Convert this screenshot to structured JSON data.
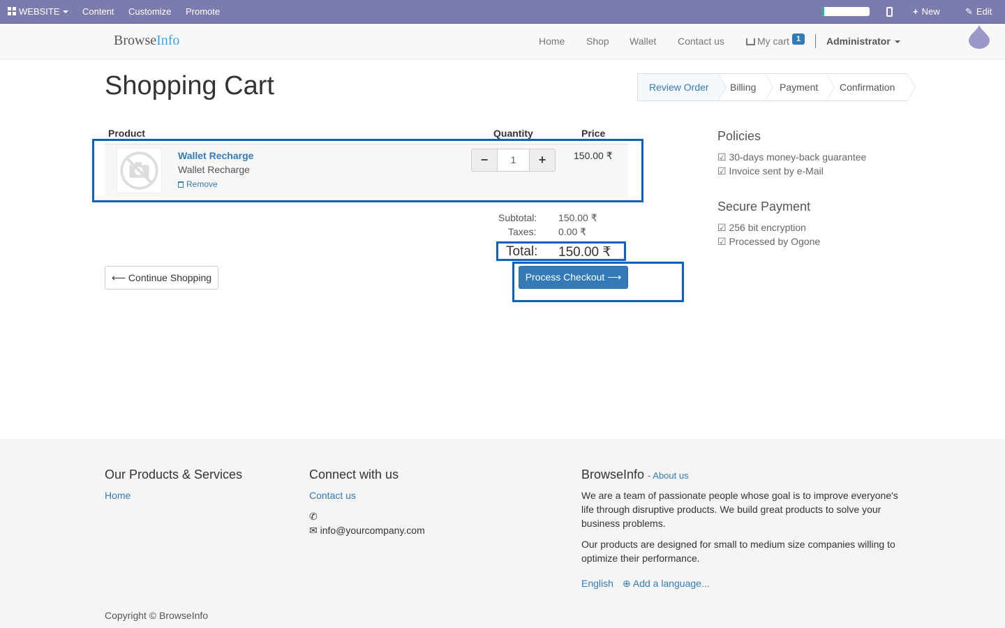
{
  "adminbar": {
    "website_label": "WEBSITE",
    "content_label": "Content",
    "customize_label": "Customize",
    "promote_label": "Promote",
    "new_label": "New",
    "edit_label": "Edit",
    "progress_fraction": 0.04
  },
  "nav": {
    "brand_part1": "Browse",
    "brand_part2": "Info",
    "home": "Home",
    "shop": "Shop",
    "wallet": "Wallet",
    "contact": "Contact us",
    "cart": "My cart",
    "cart_count": "1",
    "user": "Administrator"
  },
  "page": {
    "title": "Shopping Cart",
    "steps": [
      "Review Order",
      "Billing",
      "Payment",
      "Confirmation"
    ]
  },
  "cart": {
    "headers": {
      "product": "Product",
      "quantity": "Quantity",
      "price": "Price"
    },
    "items": [
      {
        "name": "Wallet Recharge",
        "description": "Wallet Recharge",
        "remove": "Remove",
        "quantity": "1",
        "price": "150.00 ₹"
      }
    ],
    "subtotal_label": "Subtotal:",
    "subtotal": "150.00 ₹",
    "taxes_label": "Taxes:",
    "taxes": "0.00 ₹",
    "total_label": "Total:",
    "total": "150.00 ₹",
    "continue_label": "Continue Shopping",
    "checkout_label": "Process Checkout"
  },
  "side": {
    "policies_title": "Policies",
    "policies": [
      "☑ 30-days money-back guarantee",
      "☑ Invoice sent by e-Mail"
    ],
    "secure_title": "Secure Payment",
    "secure": [
      "☑ 256 bit encryption",
      "☑ Processed by Ogone"
    ]
  },
  "footer": {
    "products_title": "Our Products & Services",
    "products_home": "Home",
    "connect_title": "Connect with us",
    "connect_contact": "Contact us",
    "email": "info@yourcompany.com",
    "about_title": "BrowseInfo",
    "about_link": "- About us",
    "about_p1": "We are a team of passionate people whose goal is to improve everyone's life through disruptive products. We build great products to solve your business problems.",
    "about_p2": "Our products are designed for small to medium size companies willing to optimize their performance.",
    "lang": "English",
    "add_lang": "Add a language...",
    "copyright": "Copyright © BrowseInfo"
  },
  "colors": {
    "adminbar": "#7c7bad",
    "primary": "#337ab7",
    "highlight": "#0b62c0"
  }
}
